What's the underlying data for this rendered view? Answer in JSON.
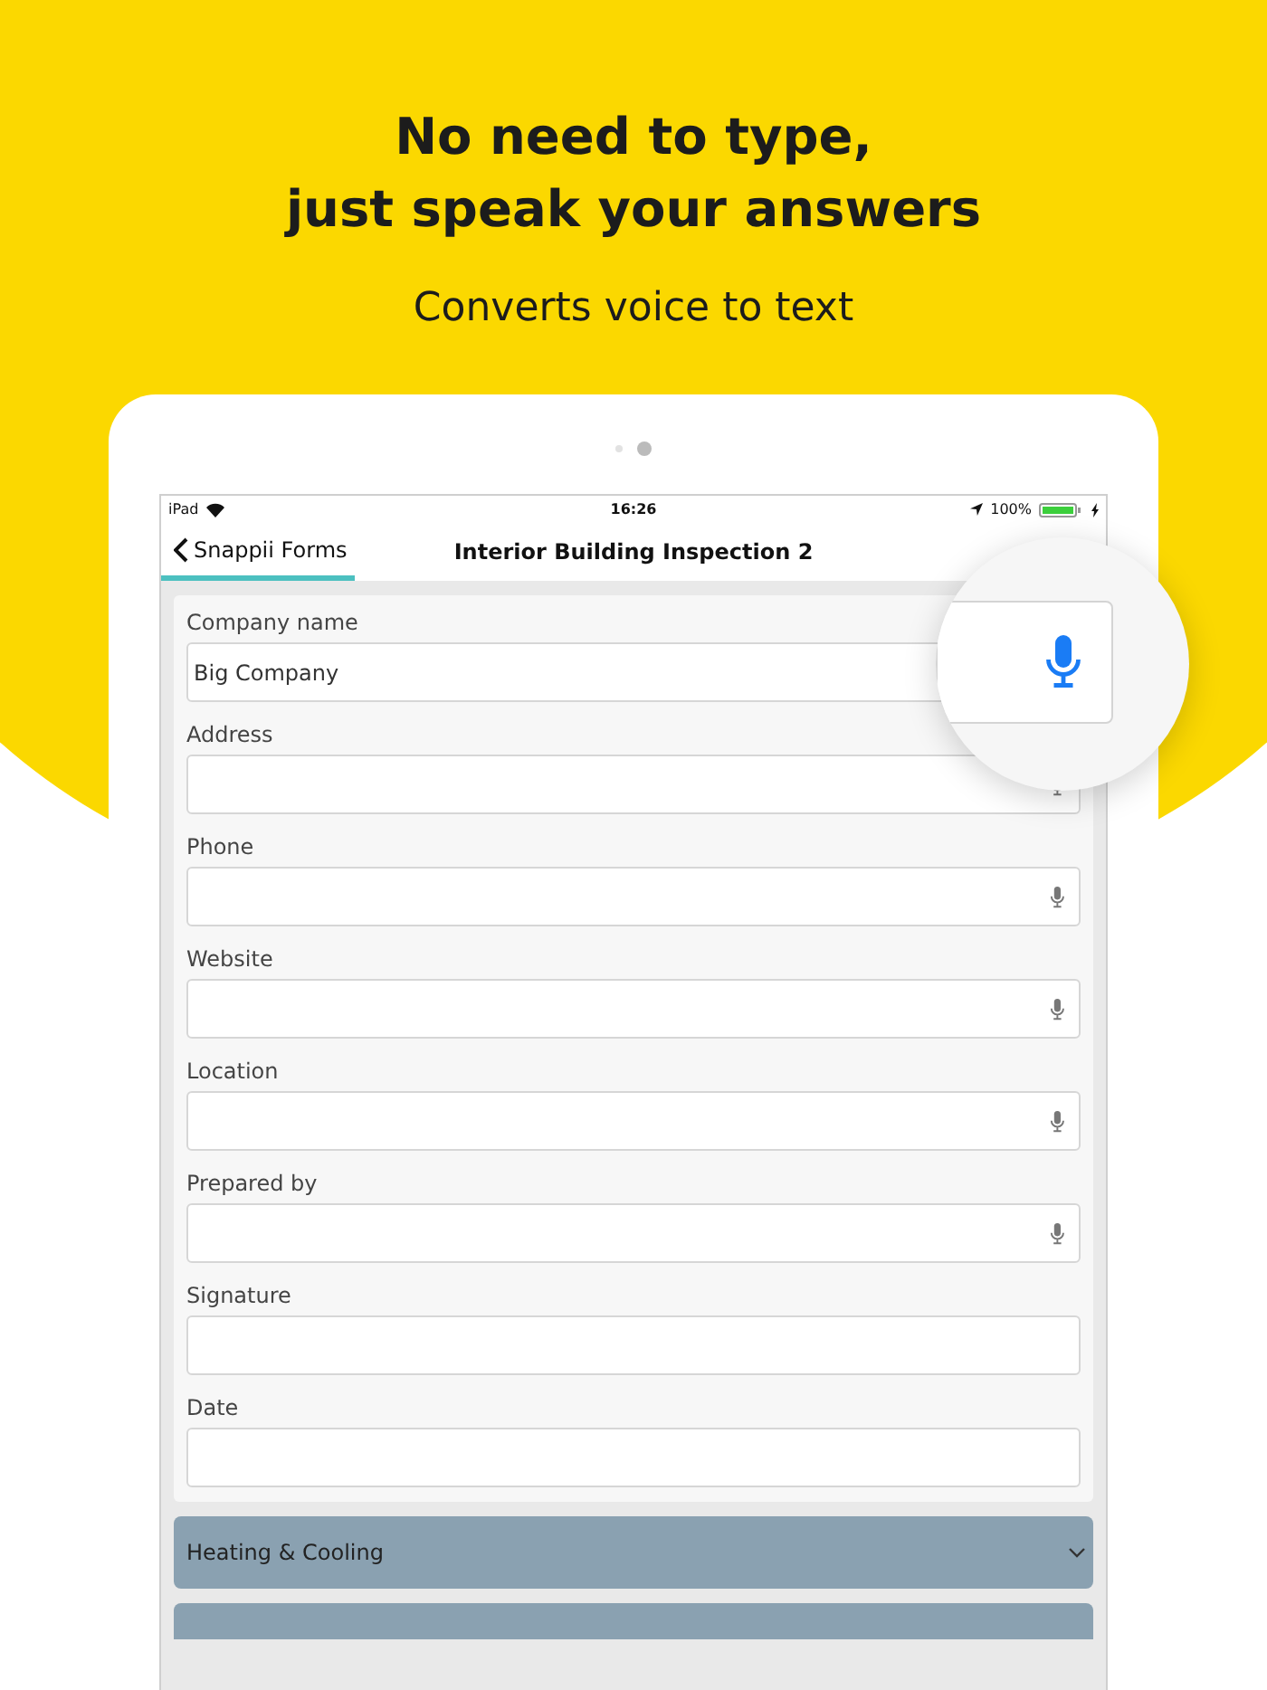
{
  "headline": {
    "lines": [
      "No need to type,",
      "just speak your answers"
    ]
  },
  "subtitle": "Converts voice to text",
  "page_dots": [
    {
      "selected": false
    },
    {
      "selected": true
    }
  ],
  "status_bar": {
    "device": "iPad",
    "time": "16:26",
    "battery": "100%"
  },
  "nav": {
    "back": "Snappii Forms",
    "title": "Interior Building Inspection 2"
  },
  "fields": [
    {
      "label": "Company name",
      "value": "Big Company",
      "voice": true
    },
    {
      "label": "Address",
      "voice": true
    },
    {
      "label": "Phone",
      "voice": true
    },
    {
      "label": "Website",
      "voice": true
    },
    {
      "label": "Location",
      "voice": true
    },
    {
      "label": "Prepared by",
      "voice": true
    },
    {
      "label": "Signature",
      "voice": false
    },
    {
      "label": "Date",
      "voice": false
    }
  ],
  "sections": [
    {
      "title": "Heating & Cooling",
      "expanded": false
    }
  ]
}
